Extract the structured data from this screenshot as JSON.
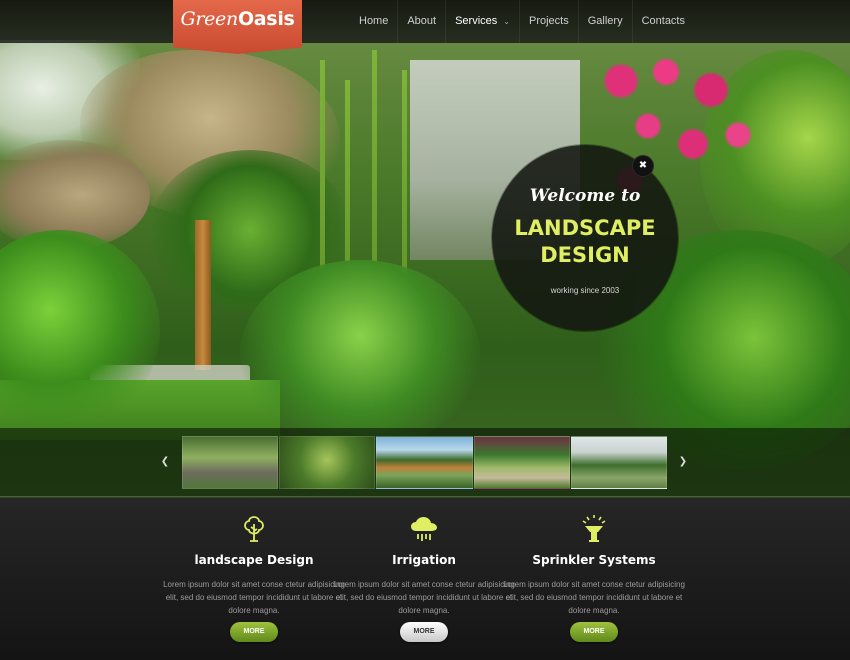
{
  "brand": {
    "logo_light": "Green",
    "logo_bold": "Oasis",
    "accent": "#d9573a",
    "highlight": "#dfee62",
    "button_green": "#7ea82d"
  },
  "nav": {
    "items": [
      {
        "label": "Home"
      },
      {
        "label": "About"
      },
      {
        "label": "Services",
        "active": true,
        "has_dropdown": true
      },
      {
        "label": "Projects"
      },
      {
        "label": "Gallery"
      },
      {
        "label": "Contacts"
      }
    ]
  },
  "hero": {
    "welcome_top": "Welcome to",
    "welcome_line1": "LANDSCAPE",
    "welcome_line2": "DESIGN",
    "welcome_sub": "working since 2003",
    "close_icon": "close-icon",
    "prev_icon": "chevron-left-icon",
    "next_icon": "chevron-right-icon"
  },
  "thumbnails": [
    "garden-path",
    "green-shrubs",
    "garden-pavilion",
    "garden-stairs",
    "topiary-garden"
  ],
  "features": [
    {
      "icon": "tree-icon",
      "title": "landscape Design",
      "text": "Lorem ipsum dolor sit amet conse ctetur adipisicing elit, sed do eiusmod tempor incididunt ut labore et dolore magna.",
      "button": "MORE"
    },
    {
      "icon": "rain-cloud-icon",
      "title": "Irrigation",
      "text": "Lorem ipsum dolor sit amet conse ctetur adipisicing elit, sed do eiusmod tempor incididunt ut labore et dolore magna.",
      "button": "MORE"
    },
    {
      "icon": "sprinkler-icon",
      "title": "Sprinkler Systems",
      "text": "Lorem ipsum dolor sit amet conse ctetur adipisicing elit, sed do eiusmod tempor incididunt ut labore et dolore magna.",
      "button": "MORE"
    }
  ]
}
